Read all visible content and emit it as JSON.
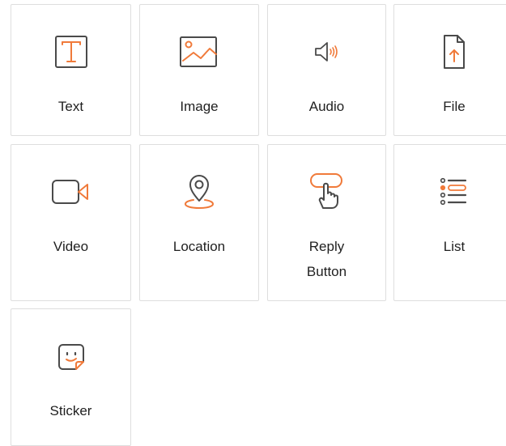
{
  "tiles": [
    {
      "label": "Text",
      "icon": "text-icon"
    },
    {
      "label": "Image",
      "icon": "image-icon"
    },
    {
      "label": "Audio",
      "icon": "audio-icon"
    },
    {
      "label": "File",
      "icon": "file-upload-icon"
    },
    {
      "label": "Video",
      "icon": "video-camera-icon"
    },
    {
      "label": "Location",
      "icon": "location-pin-icon"
    },
    {
      "label_line1": "Reply",
      "label_line2": "Button",
      "icon": "reply-button-icon"
    },
    {
      "label": "List",
      "icon": "list-icon"
    },
    {
      "label": "Sticker",
      "icon": "sticker-icon"
    }
  ],
  "colors": {
    "accent": "#f07a3a",
    "icon_stroke": "#4a4a4a",
    "border": "#dedede",
    "text": "#1f1f1f"
  }
}
